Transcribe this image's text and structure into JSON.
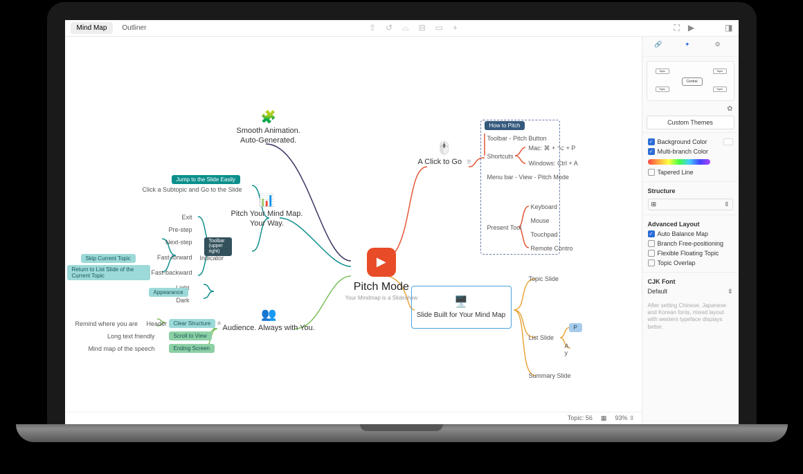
{
  "toolbar": {
    "tabs": [
      "Mind Map",
      "Outliner"
    ]
  },
  "central": {
    "title": "Pitch Mode",
    "subtitle": "Your Mindmap is a Slideshow"
  },
  "branches": {
    "animation": {
      "line1": "Smooth Animation.",
      "line2": "Auto-Generated."
    },
    "pitch_your": {
      "line1": "Pitch Your Mind Map.",
      "line2": "Your Way."
    },
    "audience": {
      "text": "Audience. Always with You."
    },
    "click_go": {
      "text": "A Click to Go"
    },
    "slide_built": {
      "text": "Slide Built for Your Mind Map"
    }
  },
  "left_cluster": {
    "pill": "Jump to the Slide Easily",
    "click_subtopic": "Click a Subtopic and Go to the Slide",
    "exit": "Exit",
    "pre_step": "Pre-step",
    "next_step": "Next-step",
    "fast_forward": "Fast-forward",
    "fast_backward": "Fast-backward",
    "light": "Light",
    "dark": "Dark",
    "skip_topic": "Skip Current Topic",
    "return_list": "Return to List Slide of the Current Topic",
    "indicator": "Indicator",
    "toolbar_note": "Toolbar (upper right)",
    "appearance": "Appearance"
  },
  "bottom_cluster": {
    "remind": "Remind where you are",
    "long_text": "Long text friendly",
    "mindmap_speech": "Mind map of the speech",
    "header": "Header",
    "clear_structure": "Clear Structure",
    "scroll_view": "Scroll to View",
    "ending_screen": "Ending Screen"
  },
  "right_cluster": {
    "how_to_pitch": "How to Pitch",
    "toolbar_pitch": "Toolbar - Pitch Button",
    "shortcuts": "Shortcuts",
    "mac": "Mac: ⌘ + ⌥ + P",
    "windows": "Windows: Ctrl + A",
    "menubar": "Menu bar - View - Pitch Mode",
    "present_tool": "Present Tool",
    "keyboard": "Keyboard",
    "mouse": "Mouse",
    "touchpad": "Touchpad",
    "remote": "Remote Contro",
    "topic_slide": "Topic Slide",
    "list_slide": "List Slide",
    "summary_slide": "Summary Slide",
    "list_p": "P",
    "list_ay": "A\ny"
  },
  "sidebar": {
    "custom_themes": "Custom Themes",
    "central_thumb": "Central",
    "topic_thumb": "Topic",
    "bg_color": "Background Color",
    "multi_branch": "Multi-branch Color",
    "tapered": "Tapered Line",
    "structure": "Structure",
    "advanced": "Advanced Layout",
    "auto_balance": "Auto Balance Map",
    "branch_free": "Branch Free-positioning",
    "flexible": "Flexible Floating Topic",
    "overlap": "Topic Overlap",
    "cjk_font": "CJK Font",
    "default": "Default",
    "cjk_help": "After setting Chinese, Japanese and Korean fonts, mixed layout with western typeface displays better."
  },
  "statusbar": {
    "topic_count_label": "Topic:",
    "topic_count": "56",
    "zoom": "93%"
  }
}
